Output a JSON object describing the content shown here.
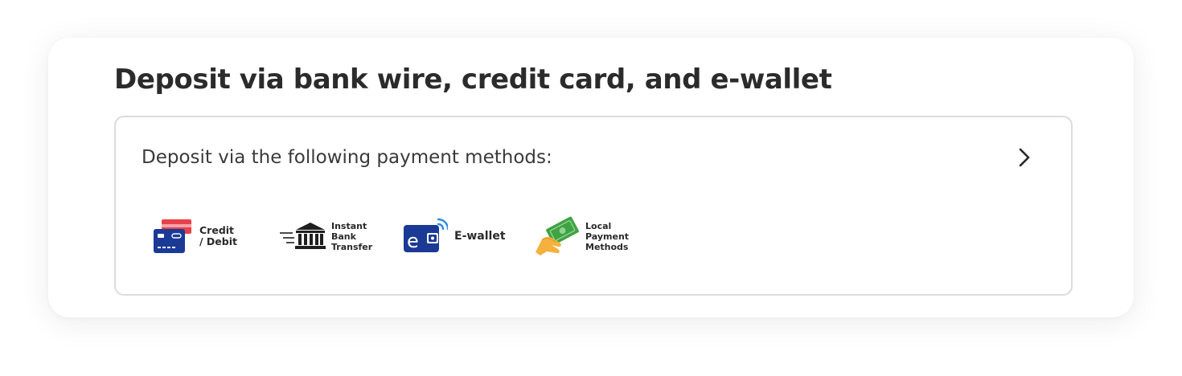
{
  "deposit": {
    "title": "Deposit via bank wire, credit card, and e-wallet",
    "subtitle": "Deposit via the following payment methods:",
    "methods": [
      {
        "label": "Credit\n/ Debit",
        "icon": "credit-card-icon",
        "colors": [
          "#e8414b",
          "#1a3a96"
        ]
      },
      {
        "label": "Instant\nBank\nTransfer",
        "icon": "bank-icon",
        "colors": [
          "#1f1f1f"
        ]
      },
      {
        "label": "E-wallet",
        "icon": "ewallet-icon",
        "colors": [
          "#1a3a96",
          "#2f8de4"
        ]
      },
      {
        "label": "Local\nPayment\nMethods",
        "icon": "cash-hand-icon",
        "colors": [
          "#3fa243",
          "#f4b13e"
        ]
      }
    ],
    "chevron_icon": "chevron-right-icon"
  }
}
